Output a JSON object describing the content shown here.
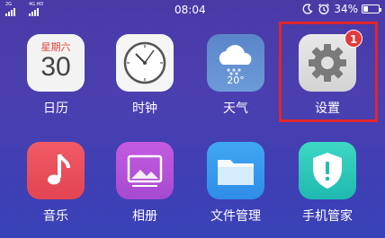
{
  "statusbar": {
    "sim1": "2G",
    "sim2": "4G HD",
    "time": "08:04",
    "battery_text": "34%",
    "battery_level": 0.34,
    "alarm_icon": "alarm-icon",
    "dnd_icon": "do-not-disturb-icon"
  },
  "apps": {
    "calendar": {
      "label": "日历",
      "weekday": "星期六",
      "date": "30",
      "icon": "calendar-icon"
    },
    "clock": {
      "label": "时钟",
      "icon": "clock-icon"
    },
    "weather": {
      "label": "天气",
      "temperature": "20°",
      "icon": "weather-icon"
    },
    "settings": {
      "label": "设置",
      "badge": "1",
      "icon": "gear-icon"
    },
    "music": {
      "label": "音乐",
      "icon": "music-note-icon"
    },
    "photos": {
      "label": "相册",
      "icon": "photo-icon"
    },
    "files": {
      "label": "文件管理",
      "icon": "folder-icon"
    },
    "phone_manager": {
      "label": "手机管家",
      "icon": "shield-icon"
    }
  },
  "colors": {
    "highlight": "#e0262c",
    "badge": "#e4393c"
  }
}
